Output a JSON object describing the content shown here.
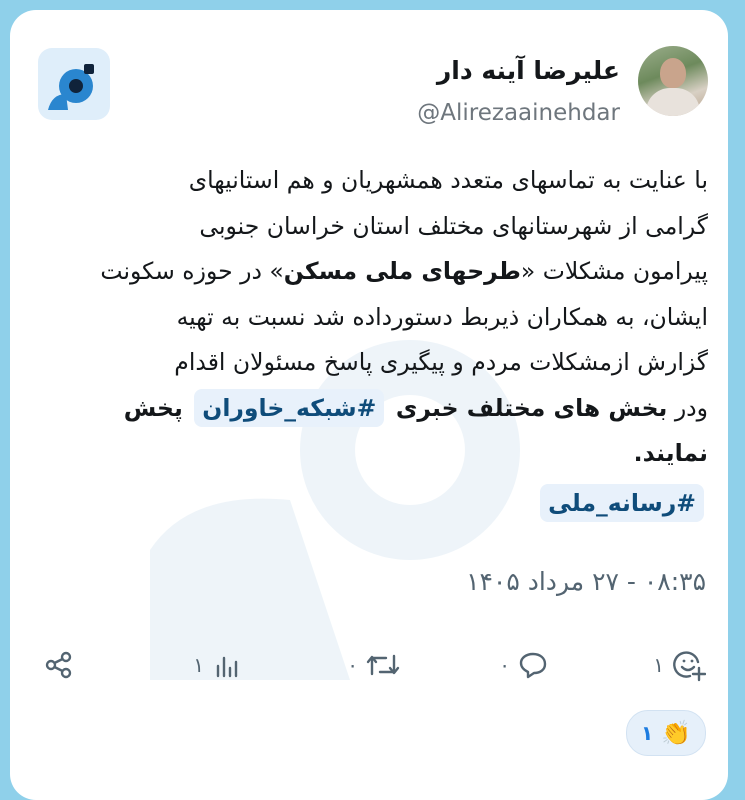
{
  "user": {
    "display_name": "علیرضا آینه دار",
    "handle": "@Alirezaainehdar"
  },
  "tweet": {
    "line1": "با عنایت به تماسهای متعدد همشهریان و هم استانیهای",
    "line2": "گرامی از شهرستانهای مختلف استان خراسان جنوبی",
    "line3_before": "پیرامون مشکلات «",
    "line3_bold": "طرحهای ملی مسکن",
    "line3_after": "» در حوزه سکونت",
    "line4": "ایشان، به همکاران ذیربط دستورداده شد نسبت به تهیه",
    "line5": "گزارش ازمشکلات مردم و پیگیری پاسخ مسئولان اقدام",
    "line6_start": "ودر ",
    "line6_bold": "بخش های مختلف خبری",
    "hashtag1": "#شبکه_خاوران",
    "line6_end": "پخش",
    "line7": "نمایند.",
    "hashtag2": "#رسانه_ملی"
  },
  "timestamp": "۰۸:۳۵ - ۲۷ مرداد ۱۴۰۵",
  "actions": {
    "reactions_count": "۱",
    "replies_count": "۰",
    "retweets_count": "۰",
    "views_count": "۱"
  },
  "reaction_badge": {
    "count": "۱",
    "emoji": "👏"
  },
  "colors": {
    "background": "#8fd0ea",
    "card": "#ffffff",
    "text": "#14171a",
    "muted": "#536471",
    "hashtag_bg": "#e8f1fb",
    "hashtag_text": "#0f4c7a",
    "accent": "#1d7ce0"
  },
  "icons": {
    "app_logo": "app-logo-icon",
    "add_reaction": "add-reaction-icon",
    "reply": "reply-icon",
    "retweet": "retweet-icon",
    "views": "views-icon",
    "share": "share-icon",
    "clap": "clap-icon"
  }
}
